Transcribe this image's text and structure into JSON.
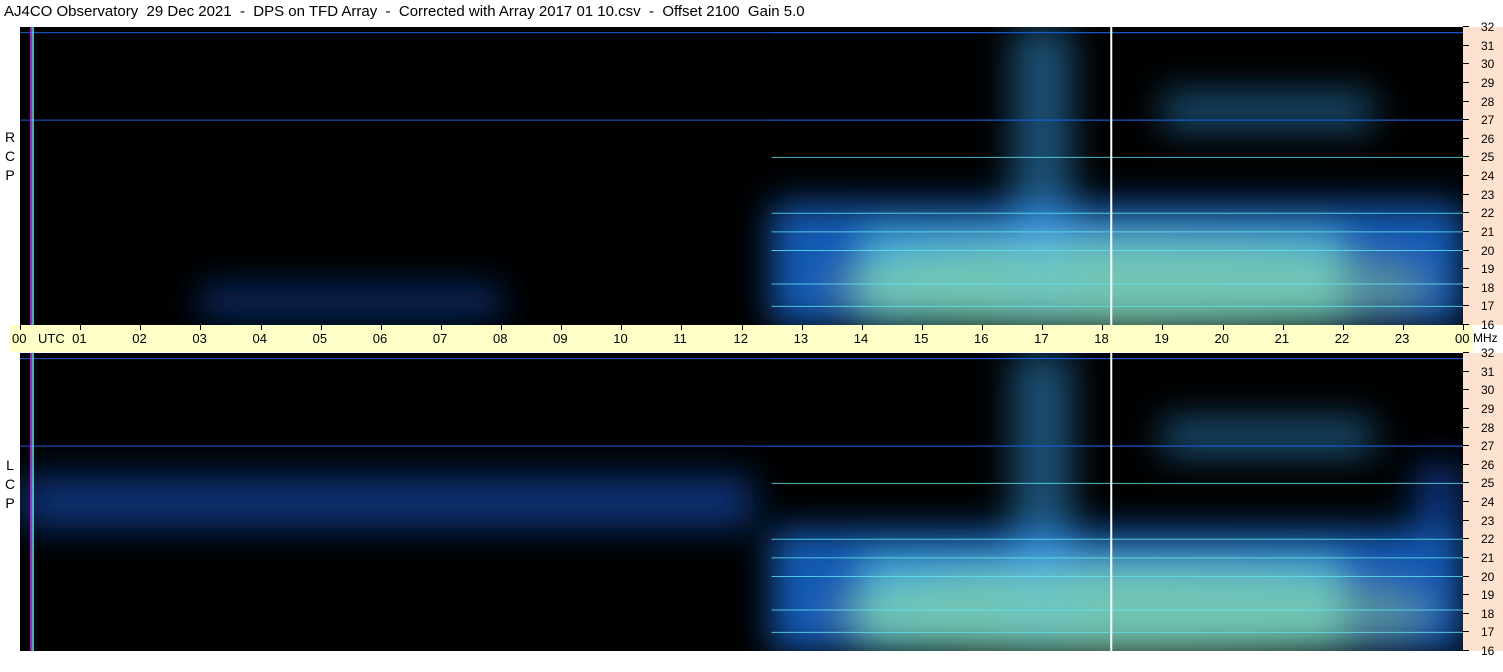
{
  "title": "AJ4CO Observatory  29 Dec 2021  -  DPS on TFD Array  -  Corrected with Array 2017 01 10.csv  -  Offset 2100  Gain 5.0",
  "panels": [
    {
      "id": "rcp",
      "label": [
        "R",
        "C",
        "P"
      ]
    },
    {
      "id": "lcp",
      "label": [
        "L",
        "C",
        "P"
      ]
    }
  ],
  "colors": {
    "background": "#000000",
    "band_blue": "#1a5cd8",
    "light_blue": "#3ab0ff",
    "cyan": "#5fe6f2",
    "yellow_green": "#c8f070",
    "marker_line": "#ffffff",
    "axis_bg": "#fde3cf",
    "time_bg": "#ffffc8"
  },
  "chart_data": {
    "type": "heatmap",
    "x_axis": {
      "label": "UTC",
      "tick_labels": [
        "00",
        "01",
        "02",
        "03",
        "04",
        "05",
        "06",
        "07",
        "08",
        "09",
        "10",
        "11",
        "12",
        "13",
        "14",
        "15",
        "16",
        "17",
        "18",
        "19",
        "20",
        "21",
        "22",
        "23",
        "00"
      ],
      "unit": "",
      "range": [
        0,
        24
      ]
    },
    "y_axis": {
      "unit": "MHz",
      "range": [
        16,
        32
      ],
      "tick_labels": [
        "32",
        "31",
        "30",
        "29",
        "28",
        "27",
        "26",
        "25",
        "24",
        "23",
        "22",
        "21",
        "20",
        "19",
        "18",
        "17",
        "16"
      ]
    },
    "marker_time_utc": 18.15,
    "series": [
      {
        "name": "RCP",
        "regions": [
          {
            "t0": 12.5,
            "t1": 24,
            "f0": 16,
            "f1": 22.5,
            "intensity": "high"
          },
          {
            "t0": 14,
            "t1": 22,
            "f0": 16,
            "f1": 21,
            "intensity": "very_high"
          },
          {
            "t0": 16.5,
            "t1": 17.5,
            "f0": 16,
            "f1": 32,
            "intensity": "medium"
          },
          {
            "t0": 19,
            "t1": 22.5,
            "f0": 26.5,
            "f1": 28.5,
            "intensity": "medium"
          },
          {
            "t0": 3,
            "t1": 8,
            "f0": 16.5,
            "f1": 18,
            "intensity": "low"
          }
        ]
      },
      {
        "name": "LCP",
        "regions": [
          {
            "t0": 0,
            "t1": 12.2,
            "f0": 22.6,
            "f1": 25.4,
            "intensity": "low"
          },
          {
            "t0": 12.5,
            "t1": 24,
            "f0": 16,
            "f1": 22.5,
            "intensity": "high"
          },
          {
            "t0": 14,
            "t1": 22,
            "f0": 16,
            "f1": 21,
            "intensity": "very_high"
          },
          {
            "t0": 16.5,
            "t1": 17.5,
            "f0": 16,
            "f1": 32,
            "intensity": "medium"
          },
          {
            "t0": 19,
            "t1": 22.5,
            "f0": 26.5,
            "f1": 28.5,
            "intensity": "medium"
          },
          {
            "t0": 23.2,
            "t1": 24,
            "f0": 22.5,
            "f1": 26,
            "intensity": "low"
          }
        ]
      }
    ],
    "interference_lines_mhz": [
      17.0,
      18.2,
      20.0,
      21.0,
      22.0,
      25.0,
      27.0,
      31.7
    ],
    "legend": "none"
  }
}
